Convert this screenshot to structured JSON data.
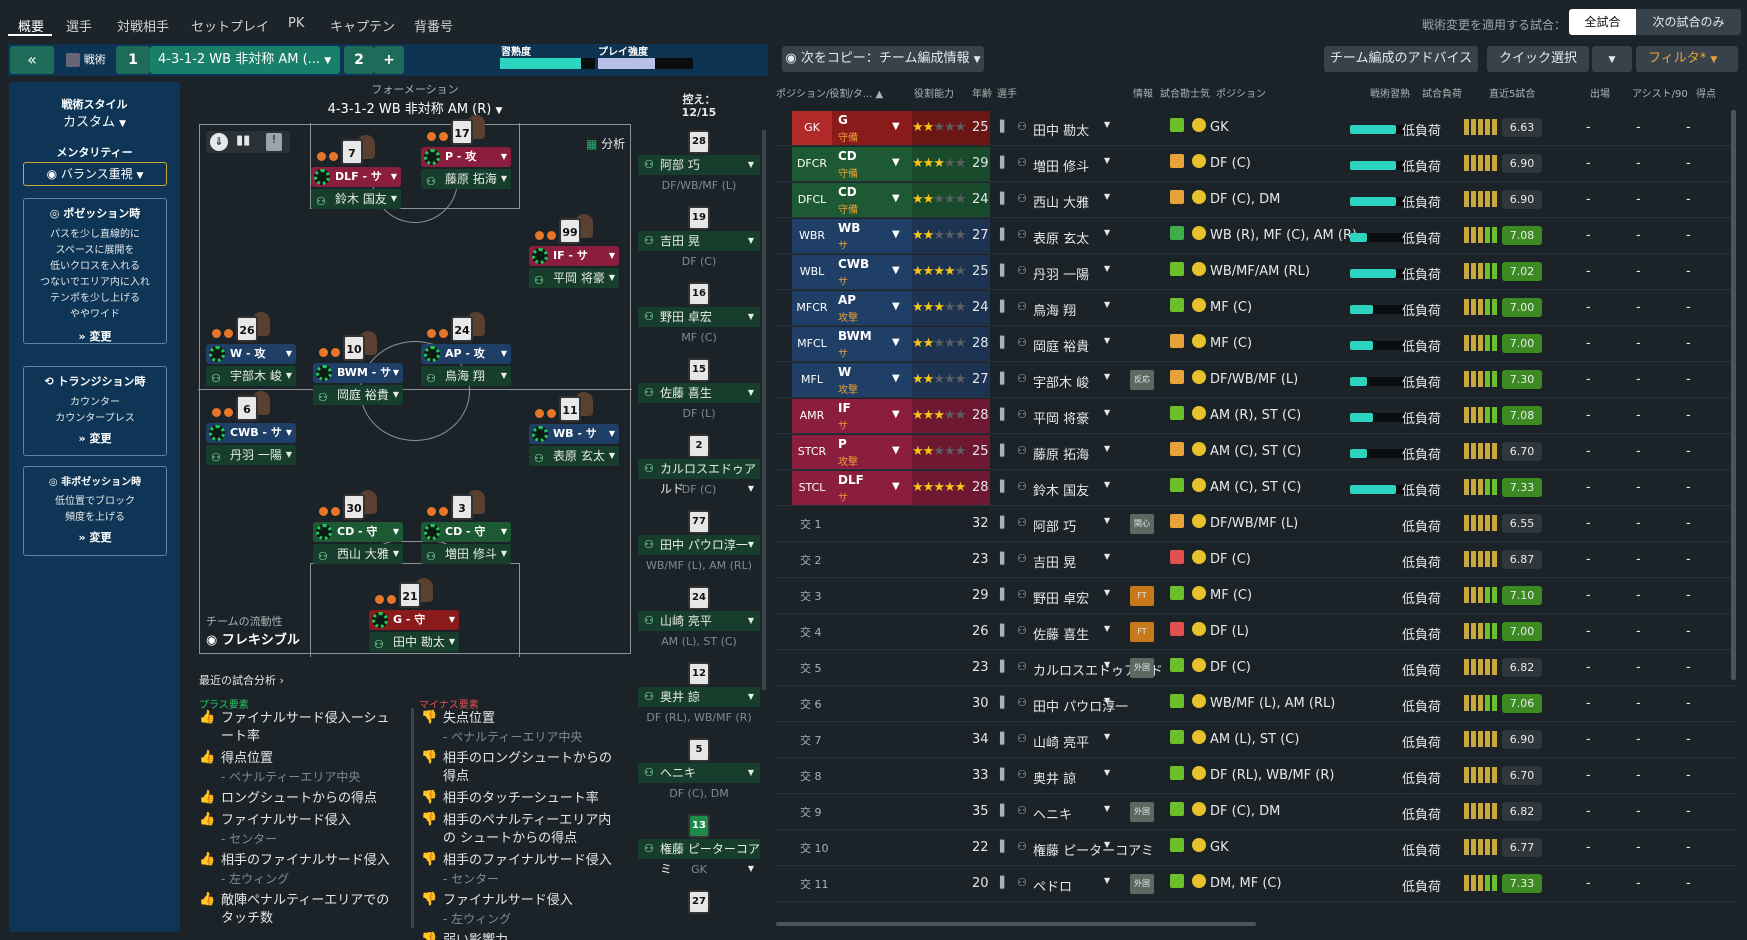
{
  "nav": {
    "tabs": [
      "概要",
      "選手",
      "対戦相手",
      "セットプレイ",
      "PK",
      "キャプテン",
      "背番号"
    ],
    "apply_label": "戦術変更を適用する試合：",
    "apply_all": "全試合",
    "apply_next": "次の試合のみ"
  },
  "tactic_bar": {
    "collapse_icon": "double-chevron-left",
    "tactic_label": "戦術",
    "slot1": "1",
    "formation_name": "4-3-1-2 WB 非対称 AM (...",
    "slot2": "2",
    "add": "+",
    "familiarity_label": "習熟度",
    "intensity_label": "プレイ強度",
    "familiarity_level": 0.85,
    "intensity_level": 0.6
  },
  "left": {
    "style_title": "戦術スタイル",
    "style_value": "カスタム",
    "mentality_title": "メンタリティー",
    "mentality_value": "バランス重視",
    "possession_title": "ポゼッション時",
    "possession_lines": [
      "パスを少し直線的に",
      "スペースに展開を",
      "低いクロスを入れる",
      "つないでエリア内に入れ",
      "テンポを少し上げる",
      "ややワイド"
    ],
    "transition_title": "トランジション時",
    "transition_lines": [
      "カウンター",
      "カウンタープレス"
    ],
    "defense_title": "非ポゼッション時",
    "defense_lines": [
      "低位置でブロック",
      "頻度を上げる"
    ],
    "change": "変更"
  },
  "pitch": {
    "formation_label": "フォーメーション",
    "formation_value": "4-3-1-2 WB 非対称 AM (R)",
    "analysis_btn": "分析",
    "fluidity_label": "チームの流動性",
    "fluidity_value": "フレキシブル",
    "players": [
      {
        "num": "7",
        "role": "DLF - サ",
        "name": "鈴木 国友",
        "color": "#8b1e3f"
      },
      {
        "num": "17",
        "role": "P - 攻",
        "name": "藤原 拓海",
        "color": "#8b1e3f"
      },
      {
        "num": "99",
        "role": "IF - サ",
        "name": "平岡 将豪",
        "color": "#8b1e3f"
      },
      {
        "num": "26",
        "role": "W - 攻",
        "name": "宇部木 峻",
        "color": "#1f3f66"
      },
      {
        "num": "10",
        "role": "BWM - サ",
        "name": "岡庭 裕貴",
        "color": "#1f3f66"
      },
      {
        "num": "24",
        "role": "AP - 攻",
        "name": "鳥海 翔",
        "color": "#1f3f66"
      },
      {
        "num": "6",
        "role": "CWB - サ",
        "name": "丹羽 一陽",
        "color": "#1f3f66"
      },
      {
        "num": "11",
        "role": "WB - サ",
        "name": "表原 玄太",
        "color": "#1f3f66"
      },
      {
        "num": "30",
        "role": "CD - 守",
        "name": "西山 大雅",
        "color": "#1d5a34"
      },
      {
        "num": "3",
        "role": "CD - 守",
        "name": "増田 修斗",
        "color": "#1d5a34"
      },
      {
        "num": "21",
        "role": "G - 守",
        "name": "田中 勘太",
        "color": "#8b1a1a"
      }
    ]
  },
  "subs": {
    "label": "控え：",
    "count": "12/15",
    "list": [
      {
        "num": "28",
        "name": "阿部 巧",
        "pos": "DF/WB/MF (L)"
      },
      {
        "num": "19",
        "name": "吉田 晃",
        "pos": "DF (C)"
      },
      {
        "num": "16",
        "name": "野田 卓宏",
        "pos": "MF (C)"
      },
      {
        "num": "15",
        "name": "佐藤 喜生",
        "pos": "DF (L)"
      },
      {
        "num": "2",
        "name": "カルロスエドゥアルド",
        "pos": "DF (C)"
      },
      {
        "num": "77",
        "name": "田中 パウロ淳一",
        "pos": "WB/MF (L), AM (RL)"
      },
      {
        "num": "24",
        "name": "山崎 亮平",
        "pos": "AM (L), ST (C)"
      },
      {
        "num": "12",
        "name": "奥井 諒",
        "pos": "DF (RL), WB/MF (R)"
      },
      {
        "num": "5",
        "name": "ヘニキ",
        "pos": "DF (C), DM"
      },
      {
        "num": "13",
        "name": "権藤 ピーターコアミ",
        "pos": "GK"
      },
      {
        "num": "27",
        "name": "",
        "pos": ""
      }
    ]
  },
  "analysis": {
    "title": "最近の試合分析",
    "plus_label": "プラス要素",
    "minus_label": "マイナス要素",
    "plus": [
      {
        "t": "ファイナルサード侵入ーシュート率",
        "s": ""
      },
      {
        "t": "得点位置",
        "s": "- ペナルティーエリア中央"
      },
      {
        "t": "ロングシュートからの得点",
        "s": ""
      },
      {
        "t": "ファイナルサード侵入",
        "s": "- センター"
      },
      {
        "t": "相手のファイナルサード侵入",
        "s": "- 左ウィング"
      },
      {
        "t": "敵陣ペナルティーエリアでの タッチ数",
        "s": ""
      }
    ],
    "minus": [
      {
        "t": "失点位置",
        "s": "- ペナルティーエリア中央"
      },
      {
        "t": "相手のロングシュートからの得点",
        "s": ""
      },
      {
        "t": "相手のタッチーシュート率",
        "s": ""
      },
      {
        "t": "相手のペナルティーエリア内の シュートからの得点",
        "s": ""
      },
      {
        "t": "相手のファイナルサード侵入",
        "s": "- センター"
      },
      {
        "t": "ファイナルサード侵入",
        "s": "- 左ウィング"
      },
      {
        "t": "弱い影響力",
        "s": ""
      }
    ]
  },
  "right": {
    "copy_btn": "次をコピー：チーム編成情報",
    "advice_btn": "チーム編成のアドバイス",
    "quick_btn": "クイック選択",
    "filter_btn": "フィルタ*",
    "headers": [
      "ポジション/役割/タ...",
      "役割能力",
      "年齢",
      "選手",
      "情報",
      "試合勘士気",
      "ポジション",
      "戦術習熟",
      "試合負荷",
      "直近5試合",
      "出場",
      "アシスト/90",
      "得点"
    ],
    "rows": [
      {
        "pos": "GK",
        "role": "G",
        "duty": "守備",
        "age": "25",
        "name": "田中 勘太",
        "positions": "GK",
        "load": "低負荷",
        "rating": "6.63",
        "fit": 0.8,
        "stars": 2,
        "posc": "#b02a2a",
        "rolec": "#8b1a1a",
        "starc": "#6b1515",
        "morale": "#6bbf2a",
        "rc": "#2f373d",
        "info": ""
      },
      {
        "pos": "DFCR",
        "role": "CD",
        "duty": "守備",
        "age": "29",
        "name": "増田 修斗",
        "positions": "DF (C)",
        "load": "低負荷",
        "rating": "6.90",
        "fit": 0.8,
        "stars": 3,
        "posc": "#1d5a34",
        "rolec": "#1d5a34",
        "starc": "#1a4a2c",
        "morale": "#e8a23a",
        "rc": "#2f373d",
        "info": ""
      },
      {
        "pos": "DFCL",
        "role": "CD",
        "duty": "守備",
        "age": "24",
        "name": "西山 大雅",
        "positions": "DF (C), DM",
        "load": "低負荷",
        "rating": "6.90",
        "fit": 0.8,
        "stars": 2,
        "posc": "#1d5a34",
        "rolec": "#1d5a34",
        "starc": "#1a4a2c",
        "morale": "#e8a23a",
        "rc": "#2f373d",
        "info": ""
      },
      {
        "pos": "WBR",
        "role": "WB",
        "duty": "サ",
        "age": "27",
        "name": "表原 玄太",
        "positions": "WB (R), MF (C), AM (R)",
        "load": "低負荷",
        "rating": "7.08",
        "fit": 0.3,
        "stars": 2,
        "posc": "#1f3f66",
        "rolec": "#1f3f66",
        "starc": "#1c3452",
        "morale": "#3fae4a",
        "rc": "#3d8a22",
        "info": ""
      },
      {
        "pos": "WBL",
        "role": "CWB",
        "duty": "サ",
        "age": "25",
        "name": "丹羽 一陽",
        "positions": "WB/MF/AM (RL)",
        "load": "低負荷",
        "rating": "7.02",
        "fit": 0.8,
        "stars": 4,
        "posc": "#1f3f66",
        "rolec": "#1f3f66",
        "starc": "#1c3452",
        "morale": "#6bbf2a",
        "rc": "#3d8a22",
        "info": ""
      },
      {
        "pos": "MFCR",
        "role": "AP",
        "duty": "攻撃",
        "age": "24",
        "name": "鳥海 翔",
        "positions": "MF (C)",
        "load": "低負荷",
        "rating": "7.00",
        "fit": 0.4,
        "stars": 3,
        "posc": "#1f3f66",
        "rolec": "#1f3f66",
        "starc": "#1c3452",
        "morale": "#6bbf2a",
        "rc": "#3d8a22",
        "info": ""
      },
      {
        "pos": "MFCL",
        "role": "BWM",
        "duty": "サ",
        "age": "28",
        "name": "岡庭 裕貴",
        "positions": "MF (C)",
        "load": "低負荷",
        "rating": "7.00",
        "fit": 0.4,
        "stars": 2,
        "posc": "#1f3f66",
        "rolec": "#1f3f66",
        "starc": "#1c3452",
        "morale": "#e8a23a",
        "rc": "#3d8a22",
        "info": ""
      },
      {
        "pos": "MFL",
        "role": "W",
        "duty": "攻撃",
        "age": "27",
        "name": "宇部木 峻",
        "positions": "DF/WB/MF (L)",
        "load": "低負荷",
        "rating": "7.30",
        "fit": 0.3,
        "stars": 2,
        "posc": "#1f3f66",
        "rolec": "#1f3f66",
        "starc": "#1c3452",
        "morale": "#e8a23a",
        "rc": "#3d8a22",
        "info": "反応"
      },
      {
        "pos": "AMR",
        "role": "IF",
        "duty": "サ",
        "age": "28",
        "name": "平岡 将豪",
        "positions": "AM (R), ST (C)",
        "load": "低負荷",
        "rating": "7.08",
        "fit": 0.4,
        "stars": 3,
        "posc": "#8b1e3f",
        "rolec": "#8b1e3f",
        "starc": "#6e1832",
        "morale": "#6bbf2a",
        "rc": "#3d8a22",
        "info": ""
      },
      {
        "pos": "STCR",
        "role": "P",
        "duty": "攻撃",
        "age": "25",
        "name": "藤原 拓海",
        "positions": "AM (C), ST (C)",
        "load": "低負荷",
        "rating": "6.70",
        "fit": 0.3,
        "stars": 2,
        "posc": "#8b1e3f",
        "rolec": "#8b1e3f",
        "starc": "#6e1832",
        "morale": "#e8a23a",
        "rc": "#2f373d",
        "info": ""
      },
      {
        "pos": "STCL",
        "role": "DLF",
        "duty": "サ",
        "age": "28",
        "name": "鈴木 国友",
        "positions": "AM (C), ST (C)",
        "load": "低負荷",
        "rating": "7.33",
        "fit": 0.8,
        "stars": 5,
        "posc": "#8b1e3f",
        "rolec": "#8b1e3f",
        "starc": "#6e1832",
        "morale": "#6bbf2a",
        "rc": "#3d8a22",
        "info": ""
      },
      {
        "pos": "交 1",
        "age": "32",
        "name": "阿部 巧",
        "positions": "DF/WB/MF (L)",
        "load": "低負荷",
        "rating": "6.55",
        "morale": "#e8a23a",
        "rc": "#2f373d",
        "info": "関心"
      },
      {
        "pos": "交 2",
        "age": "23",
        "name": "吉田 晃",
        "positions": "DF (C)",
        "load": "低負荷",
        "rating": "6.87",
        "morale": "#e05050",
        "rc": "#2f373d",
        "info": ""
      },
      {
        "pos": "交 3",
        "age": "29",
        "name": "野田 卓宏",
        "positions": "MF (C)",
        "load": "低負荷",
        "rating": "7.10",
        "morale": "#6bbf2a",
        "rc": "#3d8a22",
        "info": "FT"
      },
      {
        "pos": "交 4",
        "age": "26",
        "name": "佐藤 喜生",
        "positions": "DF (L)",
        "load": "低負荷",
        "rating": "7.00",
        "morale": "#e05050",
        "rc": "#3d8a22",
        "info": "FT"
      },
      {
        "pos": "交 5",
        "age": "23",
        "name": "カルロスエドゥアルド",
        "positions": "DF (C)",
        "load": "低負荷",
        "rating": "6.82",
        "morale": "#6bbf2a",
        "rc": "#2f373d",
        "info": "外国"
      },
      {
        "pos": "交 6",
        "age": "30",
        "name": "田中 パウロ淳一",
        "positions": "WB/MF (L), AM (RL)",
        "load": "低負荷",
        "rating": "7.06",
        "morale": "#6bbf2a",
        "rc": "#3d8a22",
        "info": ""
      },
      {
        "pos": "交 7",
        "age": "34",
        "name": "山崎 亮平",
        "positions": "AM (L), ST (C)",
        "load": "低負荷",
        "rating": "6.90",
        "morale": "#6bbf2a",
        "rc": "#2f373d",
        "info": ""
      },
      {
        "pos": "交 8",
        "age": "33",
        "name": "奥井 諒",
        "positions": "DF (RL), WB/MF (R)",
        "load": "低負荷",
        "rating": "6.70",
        "morale": "#6bbf2a",
        "rc": "#2f373d",
        "info": ""
      },
      {
        "pos": "交 9",
        "age": "35",
        "name": "ヘニキ",
        "positions": "DF (C), DM",
        "load": "低負荷",
        "rating": "6.82",
        "morale": "#6bbf2a",
        "rc": "#2f373d",
        "info": "外国"
      },
      {
        "pos": "交 10",
        "age": "22",
        "name": "権藤 ピーターコアミ",
        "positions": "GK",
        "load": "低負荷",
        "rating": "6.77",
        "morale": "#6bbf2a",
        "rc": "#2f373d",
        "info": ""
      },
      {
        "pos": "交 11",
        "age": "20",
        "name": "ペドロ",
        "positions": "DM, MF (C)",
        "load": "低負荷",
        "rating": "7.33",
        "morale": "#6bbf2a",
        "rc": "#3d8a22",
        "info": "外国"
      }
    ]
  }
}
